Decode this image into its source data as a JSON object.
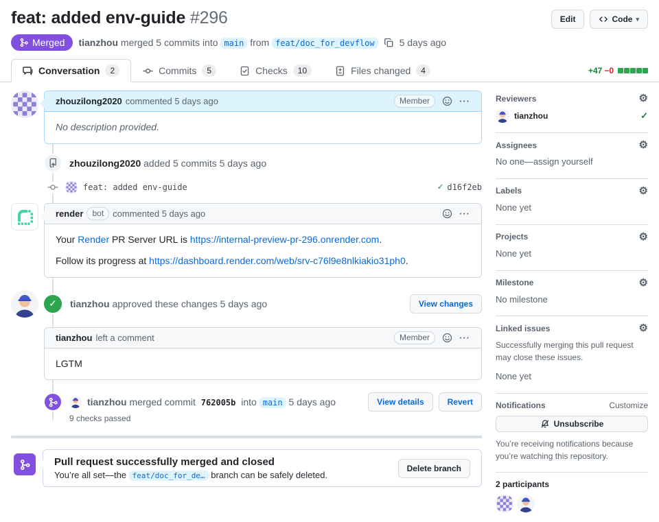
{
  "colors": {
    "merged_purple": "#8250df",
    "link_blue": "#0969da",
    "success_green": "#1a7f37",
    "danger_red": "#cf222e",
    "branch_chip_bg": "#ddf4ff"
  },
  "icons": {
    "gear": "⚙",
    "check": "✓",
    "caret_down": "▾",
    "kebab": "···"
  },
  "header": {
    "title": "feat: added env-guide",
    "number": "#296",
    "edit_button": "Edit",
    "code_button": "Code",
    "status_badge": "Merged",
    "merged_by": "tianzhou",
    "merge_action": "merged 5 commits into",
    "base_branch": "main",
    "from_label": "from",
    "head_branch": "feat/doc_for_devflow",
    "merge_time": "5 days ago"
  },
  "tabs": [
    {
      "label": "Conversation",
      "count": "2"
    },
    {
      "label": "Commits",
      "count": "5"
    },
    {
      "label": "Checks",
      "count": "10"
    },
    {
      "label": "Files changed",
      "count": "4"
    }
  ],
  "diffstat": {
    "additions": "+47",
    "deletions": "−0"
  },
  "timeline": {
    "comment1": {
      "author": "zhouzilong2020",
      "meta": "commented 5 days ago",
      "badge": "Member",
      "body": "No description provided."
    },
    "commits_event": {
      "author": "zhouzilong2020",
      "text": "added 5 commits 5 days ago"
    },
    "commit_row": {
      "message": "feat: added env-guide",
      "sha": "d16f2eb"
    },
    "bot_comment": {
      "author": "render",
      "badge": "bot",
      "meta": "commented 5 days ago",
      "line1_pre": "Your ",
      "line1_link1": "Render",
      "line1_mid": " PR Server URL is ",
      "line1_link2": "https://internal-preview-pr-296.onrender.com",
      "line1_post": ".",
      "line2_pre": "Follow its progress at ",
      "line2_link": "https://dashboard.render.com/web/srv-c76l9e8nlkiakio31ph0",
      "line2_post": "."
    },
    "approval": {
      "author": "tianzhou",
      "text": "approved these changes 5 days ago",
      "button": "View changes"
    },
    "review_comment": {
      "author": "tianzhou",
      "meta": "left a comment",
      "badge": "Member",
      "body": "LGTM"
    },
    "merge_event": {
      "author": "tianzhou",
      "action": "merged commit",
      "sha": "762005b",
      "into_label": "into",
      "branch": "main",
      "time": "5 days ago",
      "sub": "9 checks passed",
      "view_details_button": "View details",
      "revert_button": "Revert"
    }
  },
  "banner": {
    "title": "Pull request successfully merged and closed",
    "body_pre": "You’re all set—the",
    "branch": "feat/doc_for_de…",
    "body_post": "branch can be safely deleted.",
    "button": "Delete branch"
  },
  "sidebar": {
    "reviewers": {
      "title": "Reviewers",
      "user": "tianzhou"
    },
    "assignees": {
      "title": "Assignees",
      "empty": "No one—assign yourself"
    },
    "labels": {
      "title": "Labels",
      "empty": "None yet"
    },
    "projects": {
      "title": "Projects",
      "empty": "None yet"
    },
    "milestone": {
      "title": "Milestone",
      "empty": "No milestone"
    },
    "linked_issues": {
      "title": "Linked issues",
      "desc": "Successfully merging this pull request may close these issues.",
      "empty": "None yet"
    },
    "notifications": {
      "title": "Notifications",
      "customize": "Customize",
      "button": "Unsubscribe",
      "desc": "You’re receiving notifications because you’re watching this repository."
    },
    "participants": {
      "title": "2 participants"
    }
  }
}
